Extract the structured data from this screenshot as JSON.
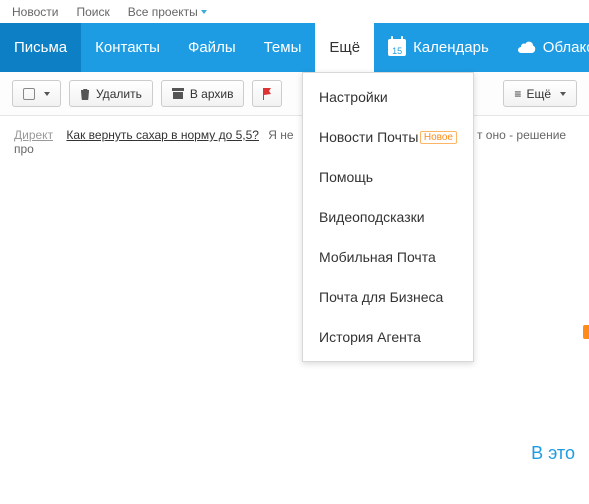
{
  "topbar": {
    "news": "Новости",
    "search": "Поиск",
    "projects": "Все проекты"
  },
  "nav": {
    "mail": "Письма",
    "contacts": "Контакты",
    "files": "Файлы",
    "themes": "Темы",
    "more": "Ещё",
    "calendar": "Календарь",
    "cal_day": "15",
    "cloud": "Облако"
  },
  "toolbar": {
    "delete": "Удалить",
    "archive": "В архив",
    "more": "Ещё"
  },
  "ad": {
    "tag": "Директ",
    "link": "Как вернуть сахар в норму до 5,5?",
    "tail_a": "Я не",
    "tail_b": "т оно - решение про"
  },
  "menu": {
    "items": [
      {
        "label": "Настройки",
        "badge": ""
      },
      {
        "label": "Новости Почты",
        "badge": "Новое"
      },
      {
        "label": "Помощь",
        "badge": ""
      },
      {
        "label": "Видеоподсказки",
        "badge": ""
      },
      {
        "label": "Мобильная Почта",
        "badge": ""
      },
      {
        "label": "Почта для Бизнеса",
        "badge": ""
      },
      {
        "label": "История Агента",
        "badge": ""
      }
    ]
  },
  "footer": {
    "partial": "В это"
  }
}
